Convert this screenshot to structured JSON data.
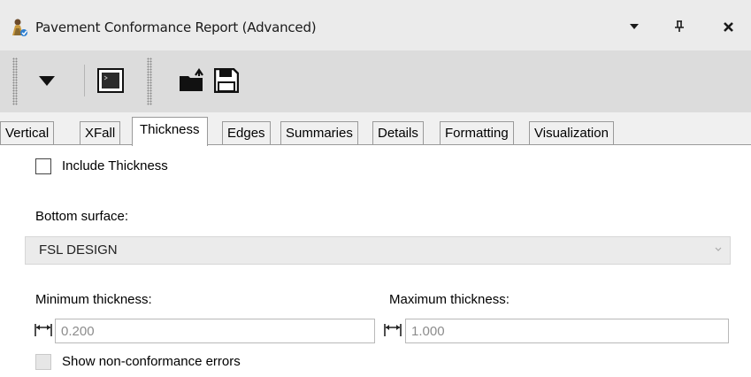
{
  "window": {
    "title": "Pavement Conformance Report (Advanced)",
    "app_icon": "person-icon",
    "controls": [
      "dropdown-arrow-icon",
      "pin-icon",
      "close-icon"
    ]
  },
  "toolbar": {
    "tools": [
      "dropdown-arrow-icon",
      "terminal-icon",
      "open-folder-icon",
      "save-icon"
    ]
  },
  "tabs": [
    {
      "label": "Vertical",
      "active": false
    },
    {
      "label": "XFall",
      "active": false
    },
    {
      "label": "Thickness",
      "active": true
    },
    {
      "label": "Edges",
      "active": false
    },
    {
      "label": "Summaries",
      "active": false
    },
    {
      "label": "Details",
      "active": false
    },
    {
      "label": "Formatting",
      "active": false
    },
    {
      "label": "Visualization",
      "active": false
    }
  ],
  "thickness": {
    "include_label": "Include Thickness",
    "include_checked": false,
    "bottom_surface_label": "Bottom surface:",
    "bottom_surface_value": "FSL DESIGN",
    "min_label": "Minimum thickness:",
    "min_value": "0.200",
    "max_label": "Maximum thickness:",
    "max_value": "1.000",
    "show_errors_label": "Show non-conformance errors",
    "show_errors_checked": false
  }
}
